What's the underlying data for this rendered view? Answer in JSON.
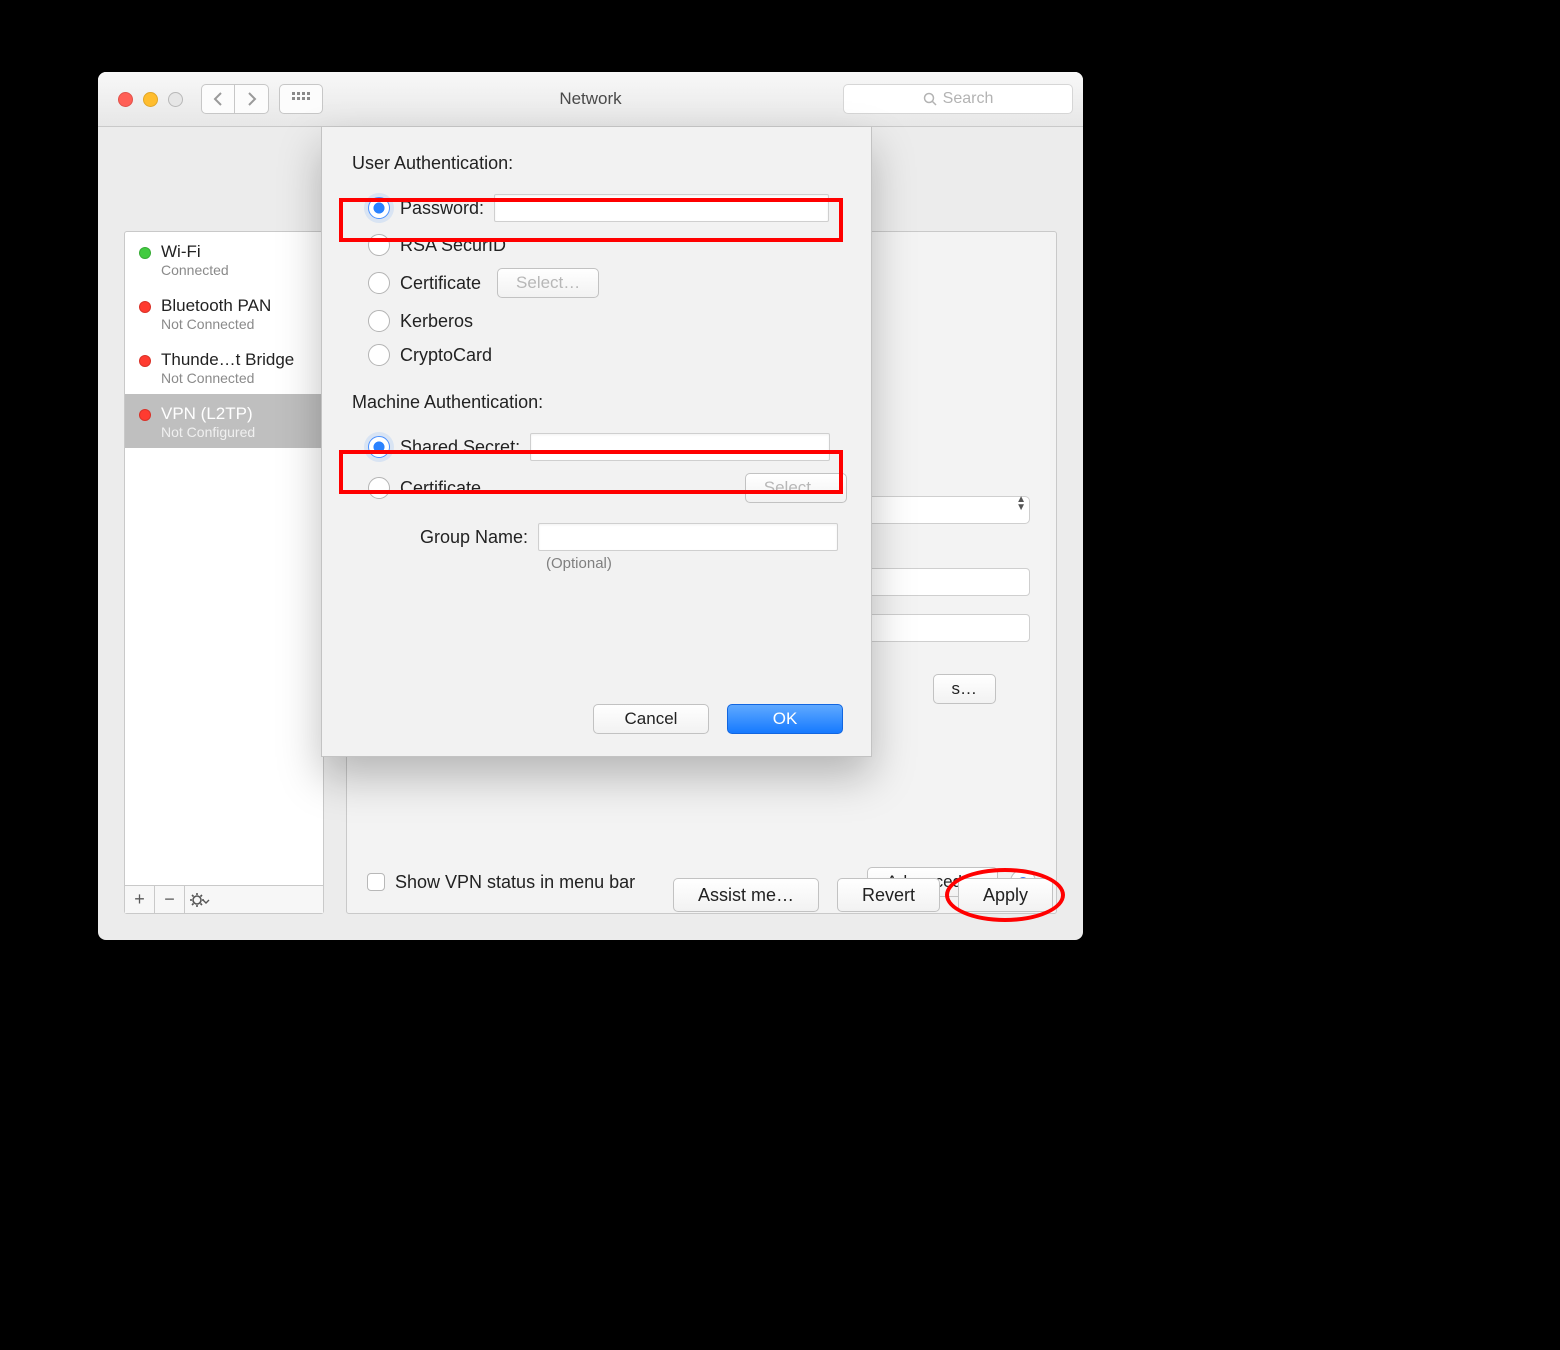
{
  "window": {
    "title": "Network",
    "search_placeholder": "Search"
  },
  "sidebar": {
    "items": [
      {
        "name": "Wi-Fi",
        "status": "Connected",
        "color": "green"
      },
      {
        "name": "Bluetooth PAN",
        "status": "Not Connected",
        "color": "red"
      },
      {
        "name": "Thunde…t Bridge",
        "status": "Not Connected",
        "color": "red"
      },
      {
        "name": "VPN (L2TP)",
        "status": "Not Configured",
        "color": "red"
      }
    ],
    "selected_index": 3,
    "foot": {
      "plus": "+",
      "minus": "−",
      "gear": "✻▾"
    }
  },
  "main": {
    "show_vpn_label": "Show VPN status in menu bar",
    "advanced_label": "Advanced…",
    "hidden_btn_label": "s…"
  },
  "footer": {
    "assist": "Assist me…",
    "revert": "Revert",
    "apply": "Apply"
  },
  "sheet": {
    "user_auth_label": "User Authentication:",
    "options_user": [
      {
        "label": "Password:",
        "selected": true,
        "has_input": true
      },
      {
        "label": "RSA SecurID",
        "selected": false
      },
      {
        "label": "Certificate",
        "selected": false,
        "select_btn": "Select…"
      },
      {
        "label": "Kerberos",
        "selected": false
      },
      {
        "label": "CryptoCard",
        "selected": false
      }
    ],
    "machine_auth_label": "Machine Authentication:",
    "options_machine": [
      {
        "label": "Shared Secret:",
        "selected": true,
        "has_input": true
      },
      {
        "label": "Certificate",
        "selected": false,
        "select_btn": "Select…"
      }
    ],
    "group_name_label": "Group Name:",
    "group_name_optional": "(Optional)",
    "cancel": "Cancel",
    "ok": "OK"
  }
}
